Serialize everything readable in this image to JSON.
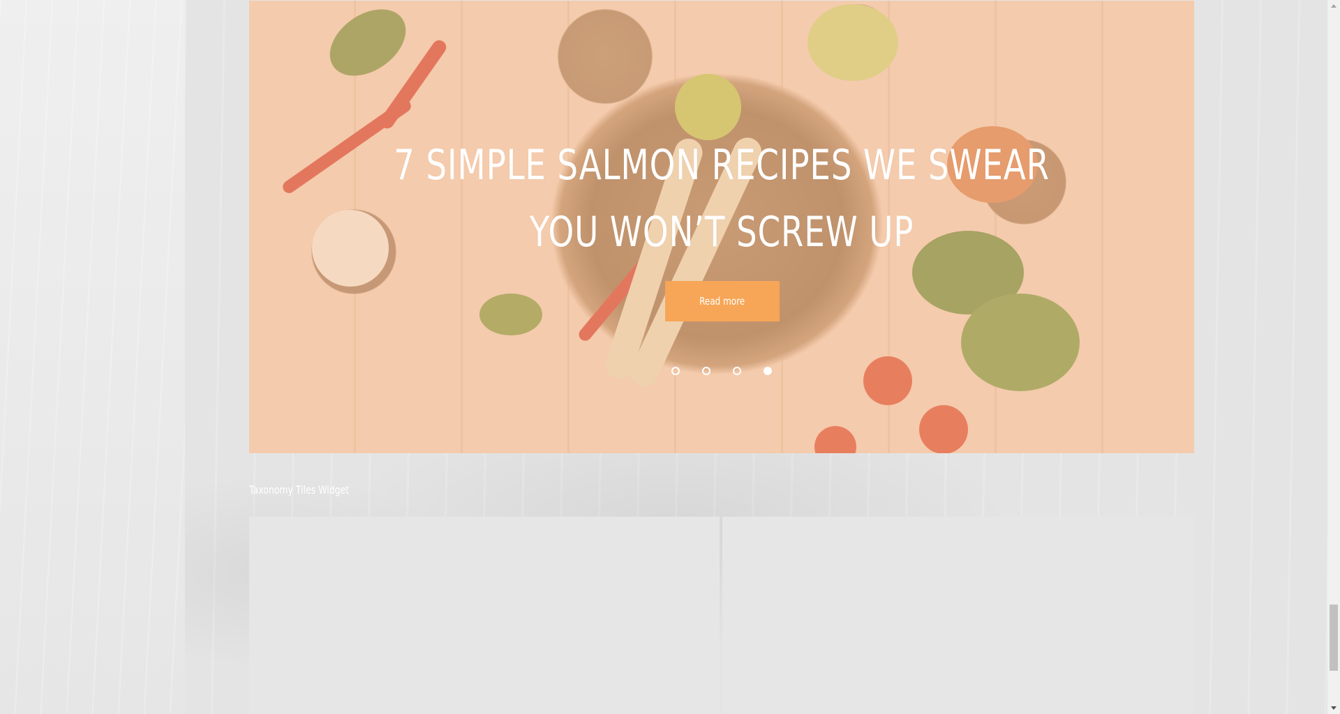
{
  "slider": {
    "title": "7 SIMPLE SALMON RECIPES WE SWEAR YOU WON’T SCREW UP",
    "read_more_label": "Read more",
    "dots": [
      {
        "active": false
      },
      {
        "active": false
      },
      {
        "active": false
      },
      {
        "active": true
      }
    ],
    "overlay_color": "#f7be96",
    "button_color": "#f6a656"
  },
  "widget": {
    "title": "Taxonomy Tiles Widget"
  }
}
